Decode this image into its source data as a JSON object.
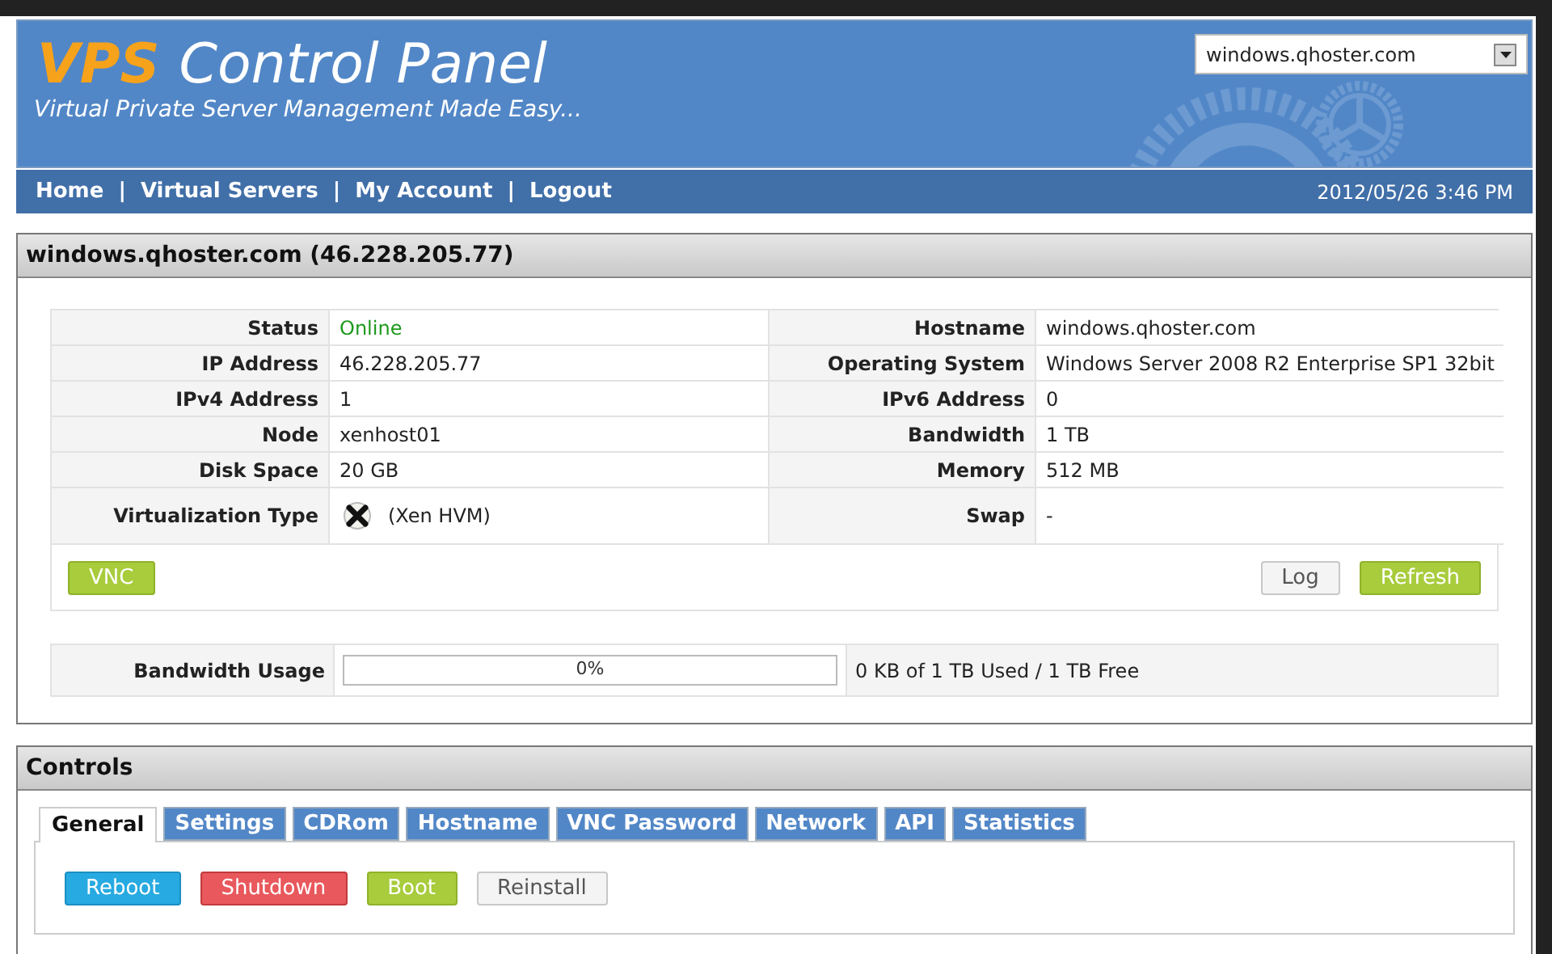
{
  "header": {
    "logo_accent": "VPS",
    "logo_rest": "Control Panel",
    "tagline": "Virtual Private Server Management Made Easy...",
    "server_select": {
      "value": "windows.qhoster.com"
    }
  },
  "nav": {
    "items": [
      "Home",
      "Virtual Servers",
      "My Account",
      "Logout"
    ],
    "separators": [
      "|",
      "|",
      "|"
    ],
    "datetime": "2012/05/26 3:46 PM"
  },
  "server_panel": {
    "title": "windows.qhoster.com (46.228.205.77)",
    "rows": [
      {
        "left_label": "Status",
        "left_value": "Online",
        "kind": "status",
        "right_label": "Hostname",
        "right_value": "windows.qhoster.com"
      },
      {
        "left_label": "IP Address",
        "left_value": "46.228.205.77",
        "kind": "text",
        "right_label": "Operating System",
        "right_value": "Windows Server 2008 R2 Enterprise SP1 32bit"
      },
      {
        "left_label": "IPv4 Address",
        "left_value": "1",
        "kind": "text",
        "right_label": "IPv6 Address",
        "right_value": "0"
      },
      {
        "left_label": "Node",
        "left_value": "xenhost01",
        "kind": "text",
        "right_label": "Bandwidth",
        "right_value": "1 TB"
      },
      {
        "left_label": "Disk Space",
        "left_value": "20 GB",
        "kind": "text",
        "right_label": "Memory",
        "right_value": "512 MB"
      },
      {
        "left_label": "Virtualization Type",
        "left_value": "(Xen HVM)",
        "kind": "xen",
        "right_label": "Swap",
        "right_value": "-"
      }
    ],
    "left_buttons": [
      {
        "label": "VNC",
        "kind": "success"
      }
    ],
    "right_buttons": [
      {
        "label": "Log",
        "kind": "default"
      },
      {
        "label": "Refresh",
        "kind": "success"
      }
    ],
    "bandwidth": {
      "label": "Bandwidth Usage",
      "level": 0,
      "reading": "0%",
      "summary": "0 KB of 1 TB Used / 1 TB Free"
    }
  },
  "controls": {
    "title": "Controls",
    "tabs": [
      {
        "label": "General",
        "selected": true
      },
      {
        "label": "Settings",
        "selected": false
      },
      {
        "label": "CDRom",
        "selected": false
      },
      {
        "label": "Hostname",
        "selected": false
      },
      {
        "label": "VNC Password",
        "selected": false
      },
      {
        "label": "Network",
        "selected": false
      },
      {
        "label": "API",
        "selected": false
      },
      {
        "label": "Statistics",
        "selected": false
      }
    ],
    "buttons": [
      {
        "label": "Reboot",
        "kind": "info"
      },
      {
        "label": "Shutdown",
        "kind": "danger"
      },
      {
        "label": "Boot",
        "kind": "success"
      },
      {
        "label": "Reinstall",
        "kind": "default"
      }
    ]
  }
}
